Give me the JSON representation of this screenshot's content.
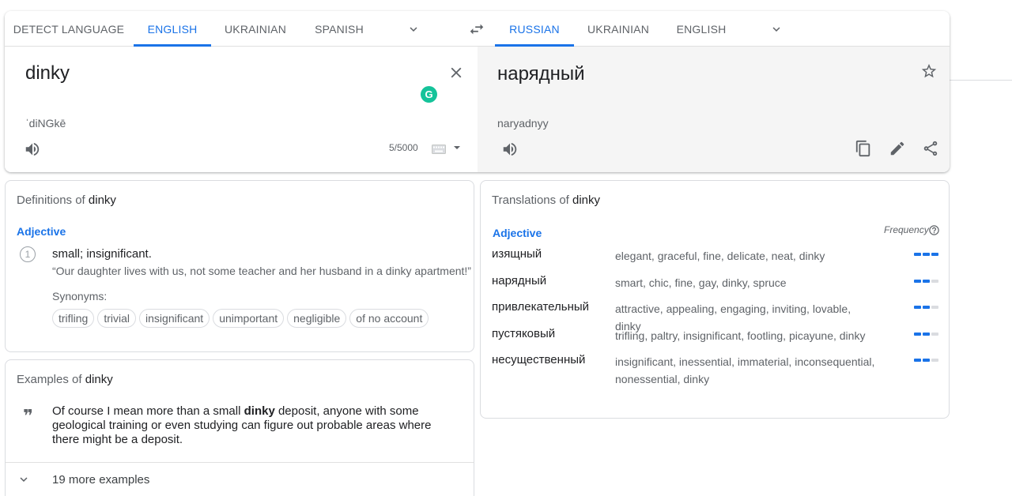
{
  "source_langs": {
    "tabs": [
      "Detect language",
      "English",
      "Ukrainian",
      "Spanish"
    ],
    "active": "English"
  },
  "target_langs": {
    "tabs": [
      "Russian",
      "Ukrainian",
      "English"
    ],
    "active": "Russian"
  },
  "source": {
    "text": "dinky",
    "transliteration": "ˈdiNGkē",
    "char_count": "5/5000"
  },
  "target": {
    "text": "нарядный",
    "transliteration": "naryadnyy"
  },
  "definitions": {
    "title_prefix": "Definitions of ",
    "word": "dinky",
    "pos": "Adjective",
    "items": [
      {
        "num": "1",
        "text": "small; insignificant.",
        "example": "“Our daughter lives with us, not some teacher and her husband in a dinky apartment!”",
        "synonyms_label": "Synonyms:",
        "synonyms": [
          "trifling",
          "trivial",
          "insignificant",
          "unimportant",
          "negligible",
          "of no account"
        ]
      }
    ]
  },
  "examples": {
    "title_prefix": "Examples of ",
    "word": "dinky",
    "text_before": "Of course I mean more than a small ",
    "text_bold": "dinky",
    "text_after": " deposit, anyone with some geological training or even studying can figure out probable areas where there might be a deposit.",
    "more_label": "19 more examples"
  },
  "translations": {
    "title_prefix": "Translations of ",
    "word": "dinky",
    "pos": "Adjective",
    "frequency_label": "Frequency",
    "rows": [
      {
        "word": "изящный",
        "back": "elegant, graceful, fine, delicate, neat, dinky",
        "freq": 3
      },
      {
        "word": "нарядный",
        "back": "smart, chic, fine, gay, dinky, spruce",
        "freq": 2
      },
      {
        "word": "привлекательный",
        "back": "attractive, appealing, engaging, inviting, lovable, dinky",
        "freq": 2
      },
      {
        "word": "пустяковый",
        "back": "trifling, paltry, insignificant, footling, picayune, dinky",
        "freq": 2
      },
      {
        "word": "несущественный",
        "back": "insignificant, inessential, immaterial, inconsequential, nonessential, dinky",
        "freq": 2
      }
    ]
  },
  "colors": {
    "accent": "#1a73e8",
    "grammarly": "#15c39a",
    "target_bg": "#f5f5f5"
  },
  "icons": [
    "chevron-down-icon",
    "swap-icon",
    "close-icon",
    "grammarly-icon",
    "speaker-icon",
    "keyboard-icon",
    "star-icon",
    "copy-icon",
    "edit-icon",
    "share-icon",
    "quote-icon",
    "help-icon"
  ]
}
